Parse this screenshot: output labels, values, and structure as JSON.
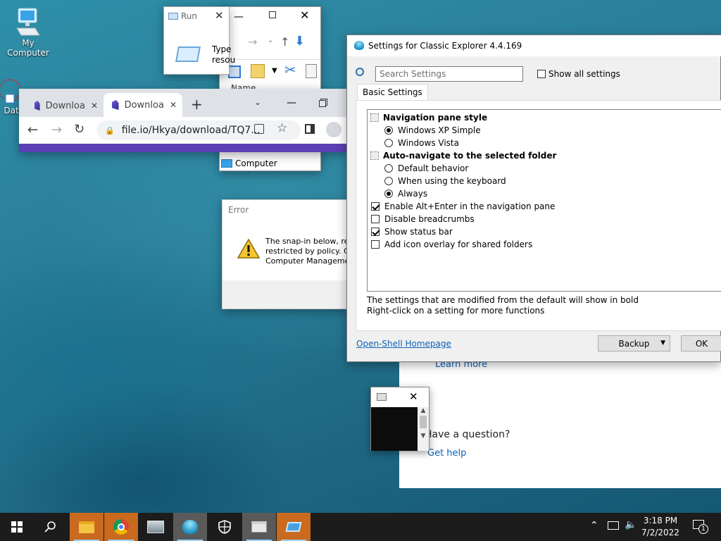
{
  "desktop": {
    "icons": [
      {
        "label": "My Computer"
      },
      {
        "label": "Data"
      }
    ]
  },
  "run_dialog": {
    "title": "Run",
    "text_line1": "Type",
    "text_line2": "resou"
  },
  "explorer": {
    "column_name": "Name",
    "nav_item": "Computer"
  },
  "browser": {
    "tabs": [
      {
        "label": "Downloa"
      },
      {
        "label": "Downloa"
      }
    ],
    "url": "file.io/Hkya/download/TQ7..."
  },
  "error_dialog": {
    "title": "Error",
    "line1": "The snap-in below, ref",
    "line2": "restricted by policy. Co",
    "line3": "Computer Managemen"
  },
  "settings_window": {
    "title": "Settings for Classic Explorer 4.4.169",
    "search_placeholder": "Search Settings",
    "show_all_label": "Show all settings",
    "show_all_checked": false,
    "tab": "Basic Settings",
    "groups": [
      {
        "label": "Navigation pane style",
        "options": [
          {
            "label": "Windows XP Simple",
            "selected": true
          },
          {
            "label": "Windows Vista",
            "selected": false
          }
        ]
      },
      {
        "label": "Auto-navigate to the selected folder",
        "options": [
          {
            "label": "Default behavior",
            "selected": false
          },
          {
            "label": "When using the keyboard",
            "selected": false
          },
          {
            "label": "Always",
            "selected": true
          }
        ]
      }
    ],
    "checkboxes": [
      {
        "label": "Enable Alt+Enter in the navigation pane",
        "checked": true
      },
      {
        "label": "Disable breadcrumbs",
        "checked": false
      },
      {
        "label": "Show status bar",
        "checked": true
      },
      {
        "label": "Add icon overlay for shared folders",
        "checked": false
      }
    ],
    "hint_line1": "The settings that are modified from the default will show in bold",
    "hint_line2": "Right-click on a setting for more functions",
    "homepage_link": "Open-Shell Homepage",
    "backup_label": "Backup",
    "ok_label": "OK"
  },
  "help_panel": {
    "learn_more": "Learn more",
    "question": "Have a question?",
    "get_help": "Get help"
  },
  "taskbar": {
    "time": "3:18 PM",
    "date": "7/2/2022",
    "notification_count": "1"
  },
  "colors": {
    "taskbar": "#1c1c1c",
    "accent_link": "#0b62b5",
    "browser_bar": "#5b3fb3"
  }
}
